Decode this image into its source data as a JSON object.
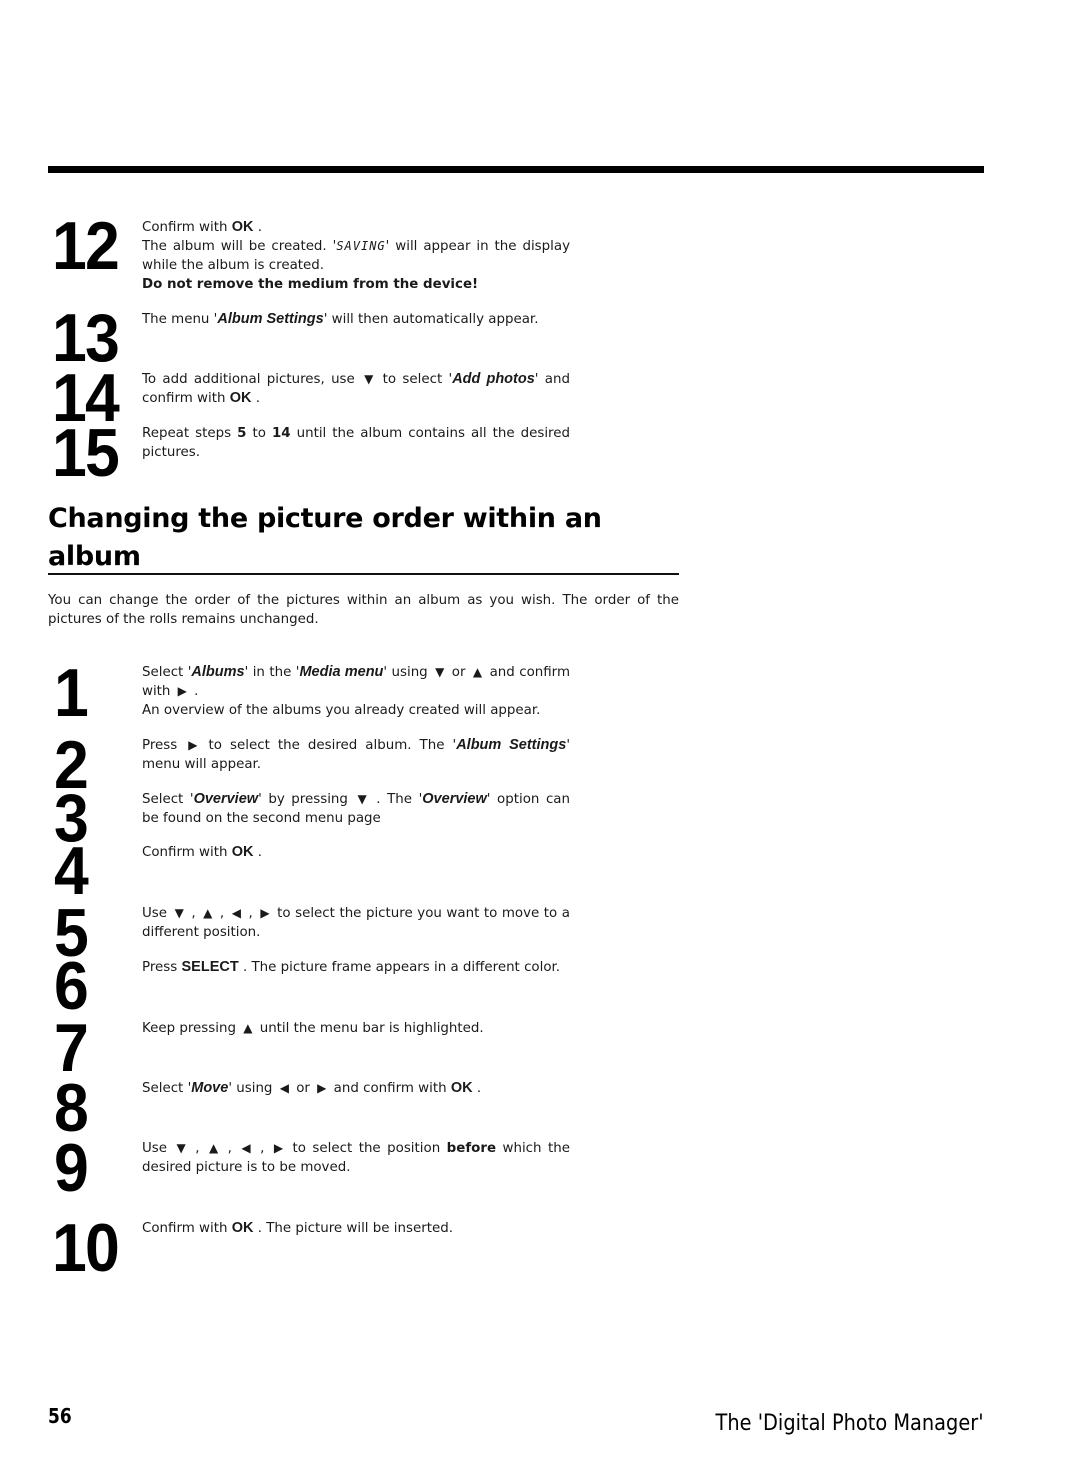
{
  "colors": {
    "text": "#111111",
    "bar": "#000000",
    "background": "#ffffff"
  },
  "icons": {
    "down": "▼",
    "up": "▲",
    "left": "◀",
    "right": "▶"
  },
  "first_section": {
    "steps": [
      {
        "number": "12",
        "line1_a": "Confirm with ",
        "line1_key": "OK",
        "line1_b": " .",
        "line2_a": "The album will be created. '",
        "line2_lcd": "SAVING",
        "line2_b": "' will appear in the display while the album is created.",
        "warning": "Do not remove the medium from the device!"
      },
      {
        "number": "13",
        "text_a": "The menu '",
        "menu": "Album Settings",
        "text_b": "' will then automatically appear."
      },
      {
        "number": "14",
        "text_a": "To add additional pictures, use ",
        "text_b": " to select '",
        "menu": "Add photos",
        "text_c": "' and confirm with ",
        "key": "OK",
        "text_d": " ."
      },
      {
        "number": "15",
        "text_a": "Repeat steps ",
        "from": "5",
        "text_b": " to ",
        "to": "14",
        "text_c": " until the album contains all the desired pictures."
      }
    ]
  },
  "section": {
    "heading": "Changing the picture order within an album",
    "intro": "You can change the order of the pictures within an album as you wish. The order of the pictures of the rolls remains unchanged.",
    "steps": [
      {
        "number": "1",
        "a": "Select '",
        "menu1": "Albums",
        "b": "' in the '",
        "menu2": "Media menu",
        "c": "' using ",
        "d": " or ",
        "e": " and confirm with ",
        "f": " .",
        "line2": "An overview of the albums you already created will appear."
      },
      {
        "number": "2",
        "a": "Press ",
        "b": " to select the desired album. The '",
        "menu": "Album Settings",
        "c": "' menu will appear."
      },
      {
        "number": "3",
        "a": "Select '",
        "menu1": "Overview",
        "b": "' by pressing ",
        "c": " . The '",
        "menu2": "Overview",
        "d": "' option can be found on the second menu page"
      },
      {
        "number": "4",
        "a": "Confirm with ",
        "key": "OK",
        "b": " ."
      },
      {
        "number": "5",
        "a": "Use ",
        "sep": " , ",
        "b": " to select the picture you want to move to a different position."
      },
      {
        "number": "6",
        "a": "Press ",
        "key": "SELECT",
        "b": " . The picture frame appears in a different color."
      },
      {
        "number": "7",
        "a": "Keep pressing ",
        "b": " until the menu bar is highlighted."
      },
      {
        "number": "8",
        "a": "Select '",
        "menu": "Move",
        "b": "' using ",
        "c": " or ",
        "d": " and confirm with ",
        "key": "OK",
        "e": " ."
      },
      {
        "number": "9",
        "a": "Use ",
        "sep": " , ",
        "b": " to select the position ",
        "bold": "before",
        "c": " which the desired picture is to be moved."
      },
      {
        "number": "10",
        "a": "Confirm with ",
        "key": "OK",
        "b": " . The picture will be inserted."
      }
    ]
  },
  "footer": {
    "page_number": "56",
    "chapter_title": "The 'Digital Photo Manager'"
  }
}
